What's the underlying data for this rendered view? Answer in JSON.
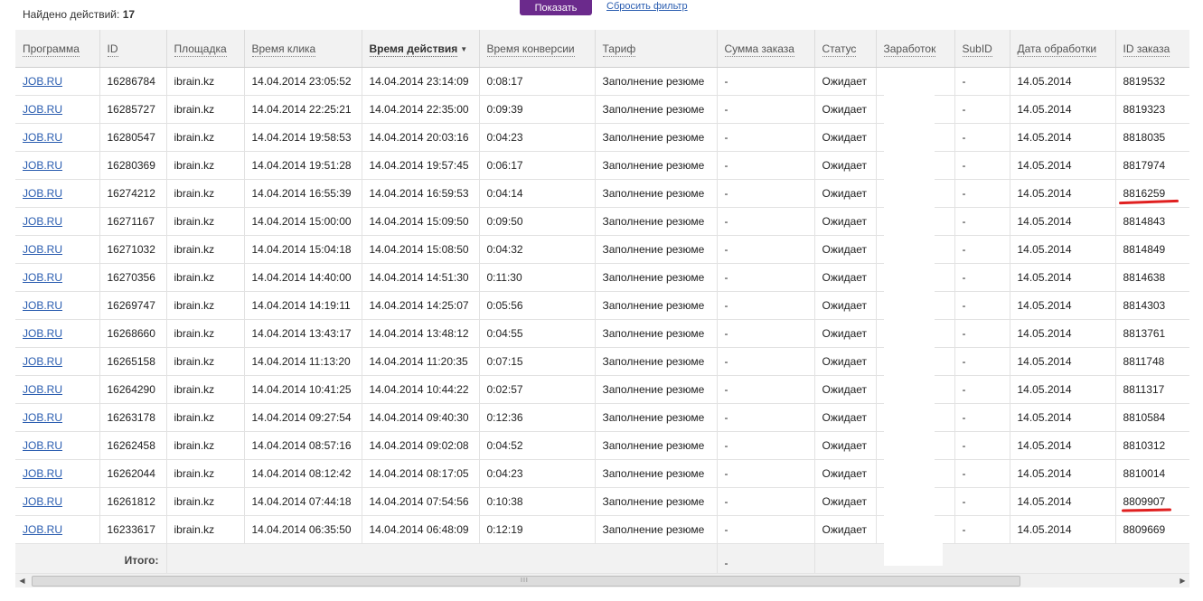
{
  "summary": {
    "found_label": "Найдено действий:",
    "found_count": "17"
  },
  "toolbar": {
    "show_label": "Показать",
    "reset_label": "Сбросить фильтр"
  },
  "columns": [
    {
      "key": "program",
      "label": "Программа"
    },
    {
      "key": "id",
      "label": "ID"
    },
    {
      "key": "site",
      "label": "Площадка"
    },
    {
      "key": "click_time",
      "label": "Время клика"
    },
    {
      "key": "action_time",
      "label": "Время действия",
      "sorted": "desc"
    },
    {
      "key": "conv_time",
      "label": "Время конверсии"
    },
    {
      "key": "tariff",
      "label": "Тариф"
    },
    {
      "key": "order_sum",
      "label": "Сумма заказа"
    },
    {
      "key": "status",
      "label": "Статус"
    },
    {
      "key": "earnings",
      "label": "Заработок"
    },
    {
      "key": "subid",
      "label": "SubID"
    },
    {
      "key": "proc_date",
      "label": "Дата обработки"
    },
    {
      "key": "order_id",
      "label": "ID заказа"
    }
  ],
  "rows": [
    {
      "program": "JOB.RU",
      "id": "16286784",
      "site": "ibrain.kz",
      "click_time": "14.04.2014 23:05:52",
      "action_time": "14.04.2014 23:14:09",
      "conv_time": "0:08:17",
      "tariff": "Заполнение резюме",
      "order_sum": "-",
      "status": "Ожидает",
      "earnings": "",
      "subid": "-",
      "proc_date": "14.05.2014",
      "order_id": "8819532"
    },
    {
      "program": "JOB.RU",
      "id": "16285727",
      "site": "ibrain.kz",
      "click_time": "14.04.2014 22:25:21",
      "action_time": "14.04.2014 22:35:00",
      "conv_time": "0:09:39",
      "tariff": "Заполнение резюме",
      "order_sum": "-",
      "status": "Ожидает",
      "earnings": "",
      "subid": "-",
      "proc_date": "14.05.2014",
      "order_id": "8819323"
    },
    {
      "program": "JOB.RU",
      "id": "16280547",
      "site": "ibrain.kz",
      "click_time": "14.04.2014 19:58:53",
      "action_time": "14.04.2014 20:03:16",
      "conv_time": "0:04:23",
      "tariff": "Заполнение резюме",
      "order_sum": "-",
      "status": "Ожидает",
      "earnings": "",
      "subid": "-",
      "proc_date": "14.05.2014",
      "order_id": "8818035"
    },
    {
      "program": "JOB.RU",
      "id": "16280369",
      "site": "ibrain.kz",
      "click_time": "14.04.2014 19:51:28",
      "action_time": "14.04.2014 19:57:45",
      "conv_time": "0:06:17",
      "tariff": "Заполнение резюме",
      "order_sum": "-",
      "status": "Ожидает",
      "earnings": "",
      "subid": "-",
      "proc_date": "14.05.2014",
      "order_id": "8817974"
    },
    {
      "program": "JOB.RU",
      "id": "16274212",
      "site": "ibrain.kz",
      "click_time": "14.04.2014 16:55:39",
      "action_time": "14.04.2014 16:59:53",
      "conv_time": "0:04:14",
      "tariff": "Заполнение резюме",
      "order_sum": "-",
      "status": "Ожидает",
      "earnings": "",
      "subid": "-",
      "proc_date": "14.05.2014",
      "order_id": "8816259"
    },
    {
      "program": "JOB.RU",
      "id": "16271167",
      "site": "ibrain.kz",
      "click_time": "14.04.2014 15:00:00",
      "action_time": "14.04.2014 15:09:50",
      "conv_time": "0:09:50",
      "tariff": "Заполнение резюме",
      "order_sum": "-",
      "status": "Ожидает",
      "earnings": "",
      "subid": "-",
      "proc_date": "14.05.2014",
      "order_id": "8814843"
    },
    {
      "program": "JOB.RU",
      "id": "16271032",
      "site": "ibrain.kz",
      "click_time": "14.04.2014 15:04:18",
      "action_time": "14.04.2014 15:08:50",
      "conv_time": "0:04:32",
      "tariff": "Заполнение резюме",
      "order_sum": "-",
      "status": "Ожидает",
      "earnings": "",
      "subid": "-",
      "proc_date": "14.05.2014",
      "order_id": "8814849"
    },
    {
      "program": "JOB.RU",
      "id": "16270356",
      "site": "ibrain.kz",
      "click_time": "14.04.2014 14:40:00",
      "action_time": "14.04.2014 14:51:30",
      "conv_time": "0:11:30",
      "tariff": "Заполнение резюме",
      "order_sum": "-",
      "status": "Ожидает",
      "earnings": "",
      "subid": "-",
      "proc_date": "14.05.2014",
      "order_id": "8814638"
    },
    {
      "program": "JOB.RU",
      "id": "16269747",
      "site": "ibrain.kz",
      "click_time": "14.04.2014 14:19:11",
      "action_time": "14.04.2014 14:25:07",
      "conv_time": "0:05:56",
      "tariff": "Заполнение резюме",
      "order_sum": "-",
      "status": "Ожидает",
      "earnings": "",
      "subid": "-",
      "proc_date": "14.05.2014",
      "order_id": "8814303"
    },
    {
      "program": "JOB.RU",
      "id": "16268660",
      "site": "ibrain.kz",
      "click_time": "14.04.2014 13:43:17",
      "action_time": "14.04.2014 13:48:12",
      "conv_time": "0:04:55",
      "tariff": "Заполнение резюме",
      "order_sum": "-",
      "status": "Ожидает",
      "earnings": "",
      "subid": "-",
      "proc_date": "14.05.2014",
      "order_id": "8813761"
    },
    {
      "program": "JOB.RU",
      "id": "16265158",
      "site": "ibrain.kz",
      "click_time": "14.04.2014 11:13:20",
      "action_time": "14.04.2014 11:20:35",
      "conv_time": "0:07:15",
      "tariff": "Заполнение резюме",
      "order_sum": "-",
      "status": "Ожидает",
      "earnings": "",
      "subid": "-",
      "proc_date": "14.05.2014",
      "order_id": "8811748"
    },
    {
      "program": "JOB.RU",
      "id": "16264290",
      "site": "ibrain.kz",
      "click_time": "14.04.2014 10:41:25",
      "action_time": "14.04.2014 10:44:22",
      "conv_time": "0:02:57",
      "tariff": "Заполнение резюме",
      "order_sum": "-",
      "status": "Ожидает",
      "earnings": "",
      "subid": "-",
      "proc_date": "14.05.2014",
      "order_id": "8811317"
    },
    {
      "program": "JOB.RU",
      "id": "16263178",
      "site": "ibrain.kz",
      "click_time": "14.04.2014 09:27:54",
      "action_time": "14.04.2014 09:40:30",
      "conv_time": "0:12:36",
      "tariff": "Заполнение резюме",
      "order_sum": "-",
      "status": "Ожидает",
      "earnings": "",
      "subid": "-",
      "proc_date": "14.05.2014",
      "order_id": "8810584"
    },
    {
      "program": "JOB.RU",
      "id": "16262458",
      "site": "ibrain.kz",
      "click_time": "14.04.2014 08:57:16",
      "action_time": "14.04.2014 09:02:08",
      "conv_time": "0:04:52",
      "tariff": "Заполнение резюме",
      "order_sum": "-",
      "status": "Ожидает",
      "earnings": "",
      "subid": "-",
      "proc_date": "14.05.2014",
      "order_id": "8810312"
    },
    {
      "program": "JOB.RU",
      "id": "16262044",
      "site": "ibrain.kz",
      "click_time": "14.04.2014 08:12:42",
      "action_time": "14.04.2014 08:17:05",
      "conv_time": "0:04:23",
      "tariff": "Заполнение резюме",
      "order_sum": "-",
      "status": "Ожидает",
      "earnings": "",
      "subid": "-",
      "proc_date": "14.05.2014",
      "order_id": "8810014"
    },
    {
      "program": "JOB.RU",
      "id": "16261812",
      "site": "ibrain.kz",
      "click_time": "14.04.2014 07:44:18",
      "action_time": "14.04.2014 07:54:56",
      "conv_time": "0:10:38",
      "tariff": "Заполнение резюме",
      "order_sum": "-",
      "status": "Ожидает",
      "earnings": "",
      "subid": "-",
      "proc_date": "14.05.2014",
      "order_id": "8809907"
    },
    {
      "program": "JOB.RU",
      "id": "16233617",
      "site": "ibrain.kz",
      "click_time": "14.04.2014 06:35:50",
      "action_time": "14.04.2014 06:48:09",
      "conv_time": "0:12:19",
      "tariff": "Заполнение резюме",
      "order_sum": "-",
      "status": "Ожидает",
      "earnings": "",
      "subid": "-",
      "proc_date": "14.05.2014",
      "order_id": "8809669"
    }
  ],
  "totals": {
    "label": "Итого:",
    "order_sum": "-"
  },
  "highlighted_order_ids": [
    "8816259",
    "8809907"
  ],
  "colors": {
    "accent": "#6b2a8c",
    "link": "#2a5db0",
    "highlight": "#e02020"
  },
  "scrollbar": {
    "grip": "III"
  }
}
